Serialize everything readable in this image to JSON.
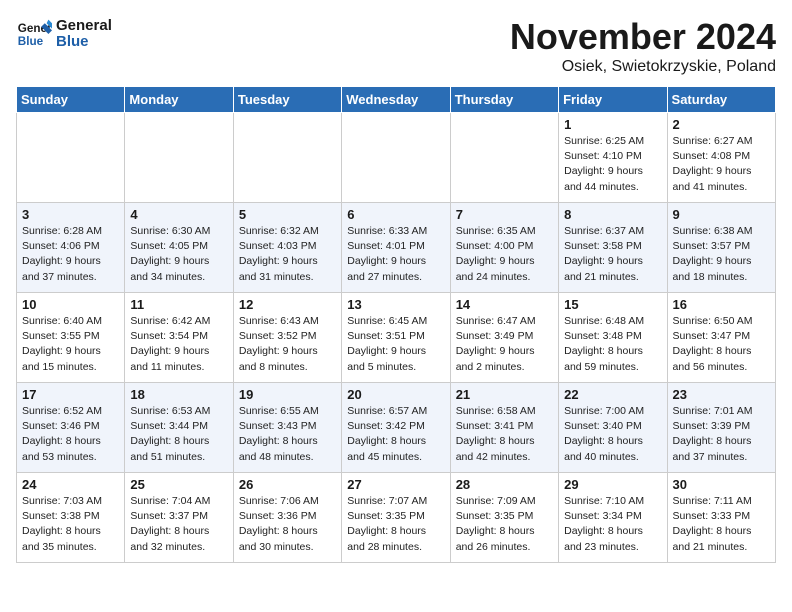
{
  "logo": {
    "general": "General",
    "blue": "Blue"
  },
  "header": {
    "month": "November 2024",
    "location": "Osiek, Swietokrzyskie, Poland"
  },
  "weekdays": [
    "Sunday",
    "Monday",
    "Tuesday",
    "Wednesday",
    "Thursday",
    "Friday",
    "Saturday"
  ],
  "weeks": [
    [
      {
        "day": "",
        "content": ""
      },
      {
        "day": "",
        "content": ""
      },
      {
        "day": "",
        "content": ""
      },
      {
        "day": "",
        "content": ""
      },
      {
        "day": "",
        "content": ""
      },
      {
        "day": "1",
        "content": "Sunrise: 6:25 AM\nSunset: 4:10 PM\nDaylight: 9 hours\nand 44 minutes."
      },
      {
        "day": "2",
        "content": "Sunrise: 6:27 AM\nSunset: 4:08 PM\nDaylight: 9 hours\nand 41 minutes."
      }
    ],
    [
      {
        "day": "3",
        "content": "Sunrise: 6:28 AM\nSunset: 4:06 PM\nDaylight: 9 hours\nand 37 minutes."
      },
      {
        "day": "4",
        "content": "Sunrise: 6:30 AM\nSunset: 4:05 PM\nDaylight: 9 hours\nand 34 minutes."
      },
      {
        "day": "5",
        "content": "Sunrise: 6:32 AM\nSunset: 4:03 PM\nDaylight: 9 hours\nand 31 minutes."
      },
      {
        "day": "6",
        "content": "Sunrise: 6:33 AM\nSunset: 4:01 PM\nDaylight: 9 hours\nand 27 minutes."
      },
      {
        "day": "7",
        "content": "Sunrise: 6:35 AM\nSunset: 4:00 PM\nDaylight: 9 hours\nand 24 minutes."
      },
      {
        "day": "8",
        "content": "Sunrise: 6:37 AM\nSunset: 3:58 PM\nDaylight: 9 hours\nand 21 minutes."
      },
      {
        "day": "9",
        "content": "Sunrise: 6:38 AM\nSunset: 3:57 PM\nDaylight: 9 hours\nand 18 minutes."
      }
    ],
    [
      {
        "day": "10",
        "content": "Sunrise: 6:40 AM\nSunset: 3:55 PM\nDaylight: 9 hours\nand 15 minutes."
      },
      {
        "day": "11",
        "content": "Sunrise: 6:42 AM\nSunset: 3:54 PM\nDaylight: 9 hours\nand 11 minutes."
      },
      {
        "day": "12",
        "content": "Sunrise: 6:43 AM\nSunset: 3:52 PM\nDaylight: 9 hours\nand 8 minutes."
      },
      {
        "day": "13",
        "content": "Sunrise: 6:45 AM\nSunset: 3:51 PM\nDaylight: 9 hours\nand 5 minutes."
      },
      {
        "day": "14",
        "content": "Sunrise: 6:47 AM\nSunset: 3:49 PM\nDaylight: 9 hours\nand 2 minutes."
      },
      {
        "day": "15",
        "content": "Sunrise: 6:48 AM\nSunset: 3:48 PM\nDaylight: 8 hours\nand 59 minutes."
      },
      {
        "day": "16",
        "content": "Sunrise: 6:50 AM\nSunset: 3:47 PM\nDaylight: 8 hours\nand 56 minutes."
      }
    ],
    [
      {
        "day": "17",
        "content": "Sunrise: 6:52 AM\nSunset: 3:46 PM\nDaylight: 8 hours\nand 53 minutes."
      },
      {
        "day": "18",
        "content": "Sunrise: 6:53 AM\nSunset: 3:44 PM\nDaylight: 8 hours\nand 51 minutes."
      },
      {
        "day": "19",
        "content": "Sunrise: 6:55 AM\nSunset: 3:43 PM\nDaylight: 8 hours\nand 48 minutes."
      },
      {
        "day": "20",
        "content": "Sunrise: 6:57 AM\nSunset: 3:42 PM\nDaylight: 8 hours\nand 45 minutes."
      },
      {
        "day": "21",
        "content": "Sunrise: 6:58 AM\nSunset: 3:41 PM\nDaylight: 8 hours\nand 42 minutes."
      },
      {
        "day": "22",
        "content": "Sunrise: 7:00 AM\nSunset: 3:40 PM\nDaylight: 8 hours\nand 40 minutes."
      },
      {
        "day": "23",
        "content": "Sunrise: 7:01 AM\nSunset: 3:39 PM\nDaylight: 8 hours\nand 37 minutes."
      }
    ],
    [
      {
        "day": "24",
        "content": "Sunrise: 7:03 AM\nSunset: 3:38 PM\nDaylight: 8 hours\nand 35 minutes."
      },
      {
        "day": "25",
        "content": "Sunrise: 7:04 AM\nSunset: 3:37 PM\nDaylight: 8 hours\nand 32 minutes."
      },
      {
        "day": "26",
        "content": "Sunrise: 7:06 AM\nSunset: 3:36 PM\nDaylight: 8 hours\nand 30 minutes."
      },
      {
        "day": "27",
        "content": "Sunrise: 7:07 AM\nSunset: 3:35 PM\nDaylight: 8 hours\nand 28 minutes."
      },
      {
        "day": "28",
        "content": "Sunrise: 7:09 AM\nSunset: 3:35 PM\nDaylight: 8 hours\nand 26 minutes."
      },
      {
        "day": "29",
        "content": "Sunrise: 7:10 AM\nSunset: 3:34 PM\nDaylight: 8 hours\nand 23 minutes."
      },
      {
        "day": "30",
        "content": "Sunrise: 7:11 AM\nSunset: 3:33 PM\nDaylight: 8 hours\nand 21 minutes."
      }
    ]
  ]
}
